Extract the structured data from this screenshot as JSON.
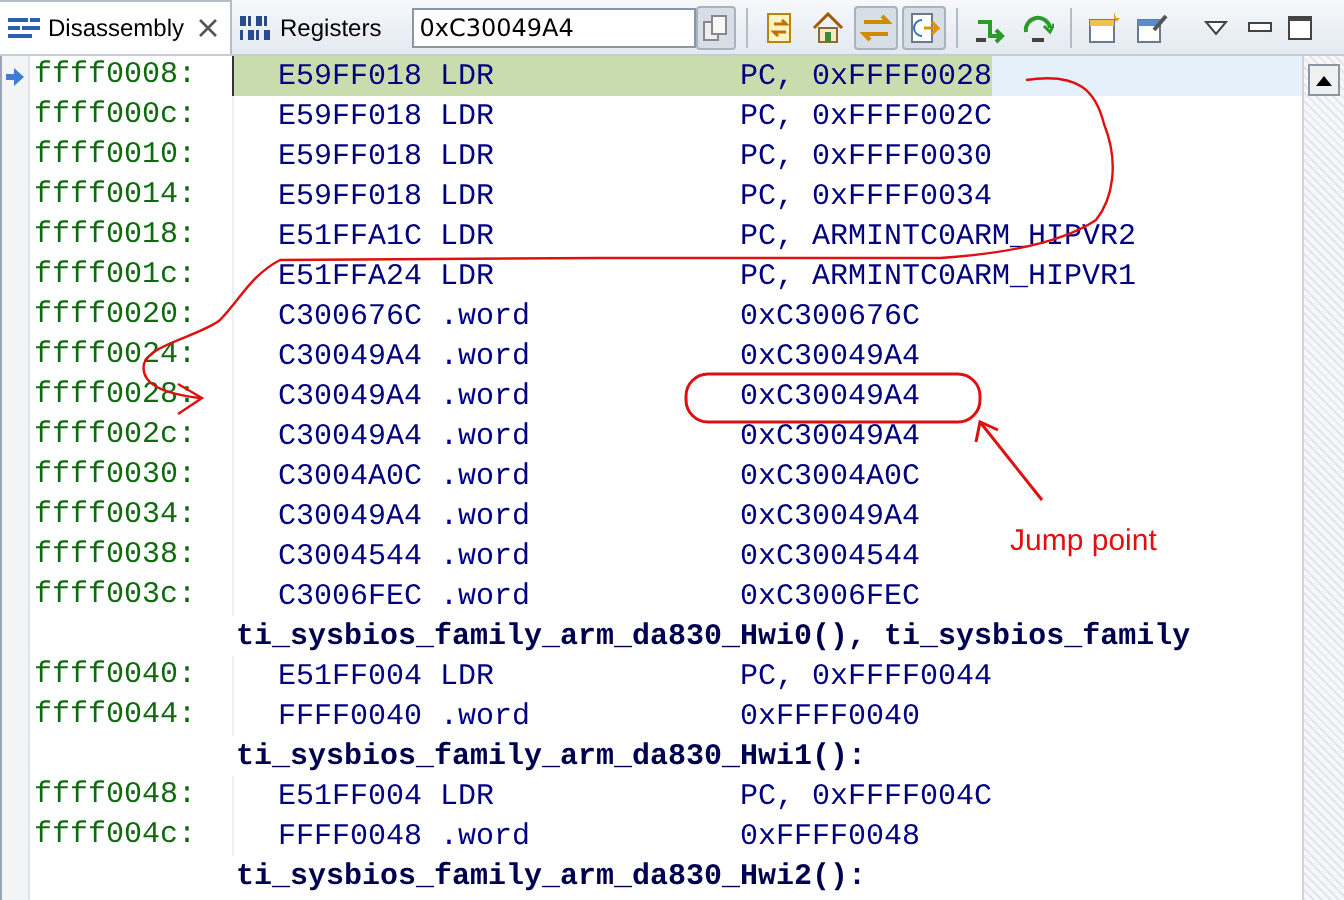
{
  "tabs": [
    {
      "label": "Disassembly",
      "selected": true,
      "closable": true,
      "kind": "disassembly"
    },
    {
      "label": "Registers",
      "selected": false,
      "closable": false,
      "kind": "registers"
    }
  ],
  "address_field": {
    "value": "0xC30049A4"
  },
  "toolbar": [
    {
      "kind": "sync",
      "pressed": false
    },
    {
      "kind": "home",
      "pressed": false
    },
    {
      "kind": "link",
      "pressed": true
    },
    {
      "kind": "track",
      "pressed": true
    },
    {
      "kind": "step",
      "pressed": false
    },
    {
      "kind": "curve",
      "pressed": false
    },
    {
      "kind": "newview",
      "pressed": false
    },
    {
      "kind": "pin",
      "pressed": false
    }
  ],
  "rows": [
    {
      "kind": "instruction",
      "address": "ffff0008:",
      "opcode": "E59FF018",
      "mnemonic": "LDR",
      "operands": "PC, 0xFFFF0028",
      "current": true
    },
    {
      "kind": "instruction",
      "address": "ffff000c:",
      "opcode": "E59FF018",
      "mnemonic": "LDR",
      "operands": "PC, 0xFFFF002C",
      "current": false
    },
    {
      "kind": "instruction",
      "address": "ffff0010:",
      "opcode": "E59FF018",
      "mnemonic": "LDR",
      "operands": "PC, 0xFFFF0030",
      "current": false
    },
    {
      "kind": "instruction",
      "address": "ffff0014:",
      "opcode": "E59FF018",
      "mnemonic": "LDR",
      "operands": "PC, 0xFFFF0034",
      "current": false
    },
    {
      "kind": "instruction",
      "address": "ffff0018:",
      "opcode": "E51FFA1C",
      "mnemonic": "LDR",
      "operands": "PC, ARMINTC0ARM_HIPVR2",
      "current": false
    },
    {
      "kind": "instruction",
      "address": "ffff001c:",
      "opcode": "E51FFA24",
      "mnemonic": "LDR",
      "operands": "PC, ARMINTC0ARM_HIPVR1",
      "current": false
    },
    {
      "kind": "instruction",
      "address": "ffff0020:",
      "opcode": "C300676C",
      "mnemonic": ".word",
      "operands": "0xC300676C",
      "current": false
    },
    {
      "kind": "instruction",
      "address": "ffff0024:",
      "opcode": "C30049A4",
      "mnemonic": ".word",
      "operands": "0xC30049A4",
      "current": false
    },
    {
      "kind": "instruction",
      "address": "ffff0028:",
      "opcode": "C30049A4",
      "mnemonic": ".word",
      "operands": "0xC30049A4",
      "current": false
    },
    {
      "kind": "instruction",
      "address": "ffff002c:",
      "opcode": "C30049A4",
      "mnemonic": ".word",
      "operands": "0xC30049A4",
      "current": false
    },
    {
      "kind": "instruction",
      "address": "ffff0030:",
      "opcode": "C3004A0C",
      "mnemonic": ".word",
      "operands": "0xC3004A0C",
      "current": false
    },
    {
      "kind": "instruction",
      "address": "ffff0034:",
      "opcode": "C30049A4",
      "mnemonic": ".word",
      "operands": "0xC30049A4",
      "current": false
    },
    {
      "kind": "instruction",
      "address": "ffff0038:",
      "opcode": "C3004544",
      "mnemonic": ".word",
      "operands": "0xC3004544",
      "current": false
    },
    {
      "kind": "instruction",
      "address": "ffff003c:",
      "opcode": "C3006FEC",
      "mnemonic": ".word",
      "operands": "0xC3006FEC",
      "current": false
    },
    {
      "kind": "label",
      "text": "ti_sysbios_family_arm_da830_Hwi0(), ti_sysbios_family"
    },
    {
      "kind": "instruction",
      "address": "ffff0040:",
      "opcode": "E51FF004",
      "mnemonic": "LDR",
      "operands": "PC, 0xFFFF0044",
      "current": false
    },
    {
      "kind": "instruction",
      "address": "ffff0044:",
      "opcode": "FFFF0040",
      "mnemonic": ".word",
      "operands": "0xFFFF0040",
      "current": false
    },
    {
      "kind": "label",
      "text": "ti_sysbios_family_arm_da830_Hwi1():"
    },
    {
      "kind": "instruction",
      "address": "ffff0048:",
      "opcode": "E51FF004",
      "mnemonic": "LDR",
      "operands": "PC, 0xFFFF004C",
      "current": false
    },
    {
      "kind": "instruction",
      "address": "ffff004c:",
      "opcode": "FFFF0048",
      "mnemonic": ".word",
      "operands": "0xFFFF0048",
      "current": false
    },
    {
      "kind": "label",
      "text": "ti_sysbios_family_arm_da830_Hwi2():"
    }
  ],
  "annotation": {
    "label": "Jump point"
  }
}
